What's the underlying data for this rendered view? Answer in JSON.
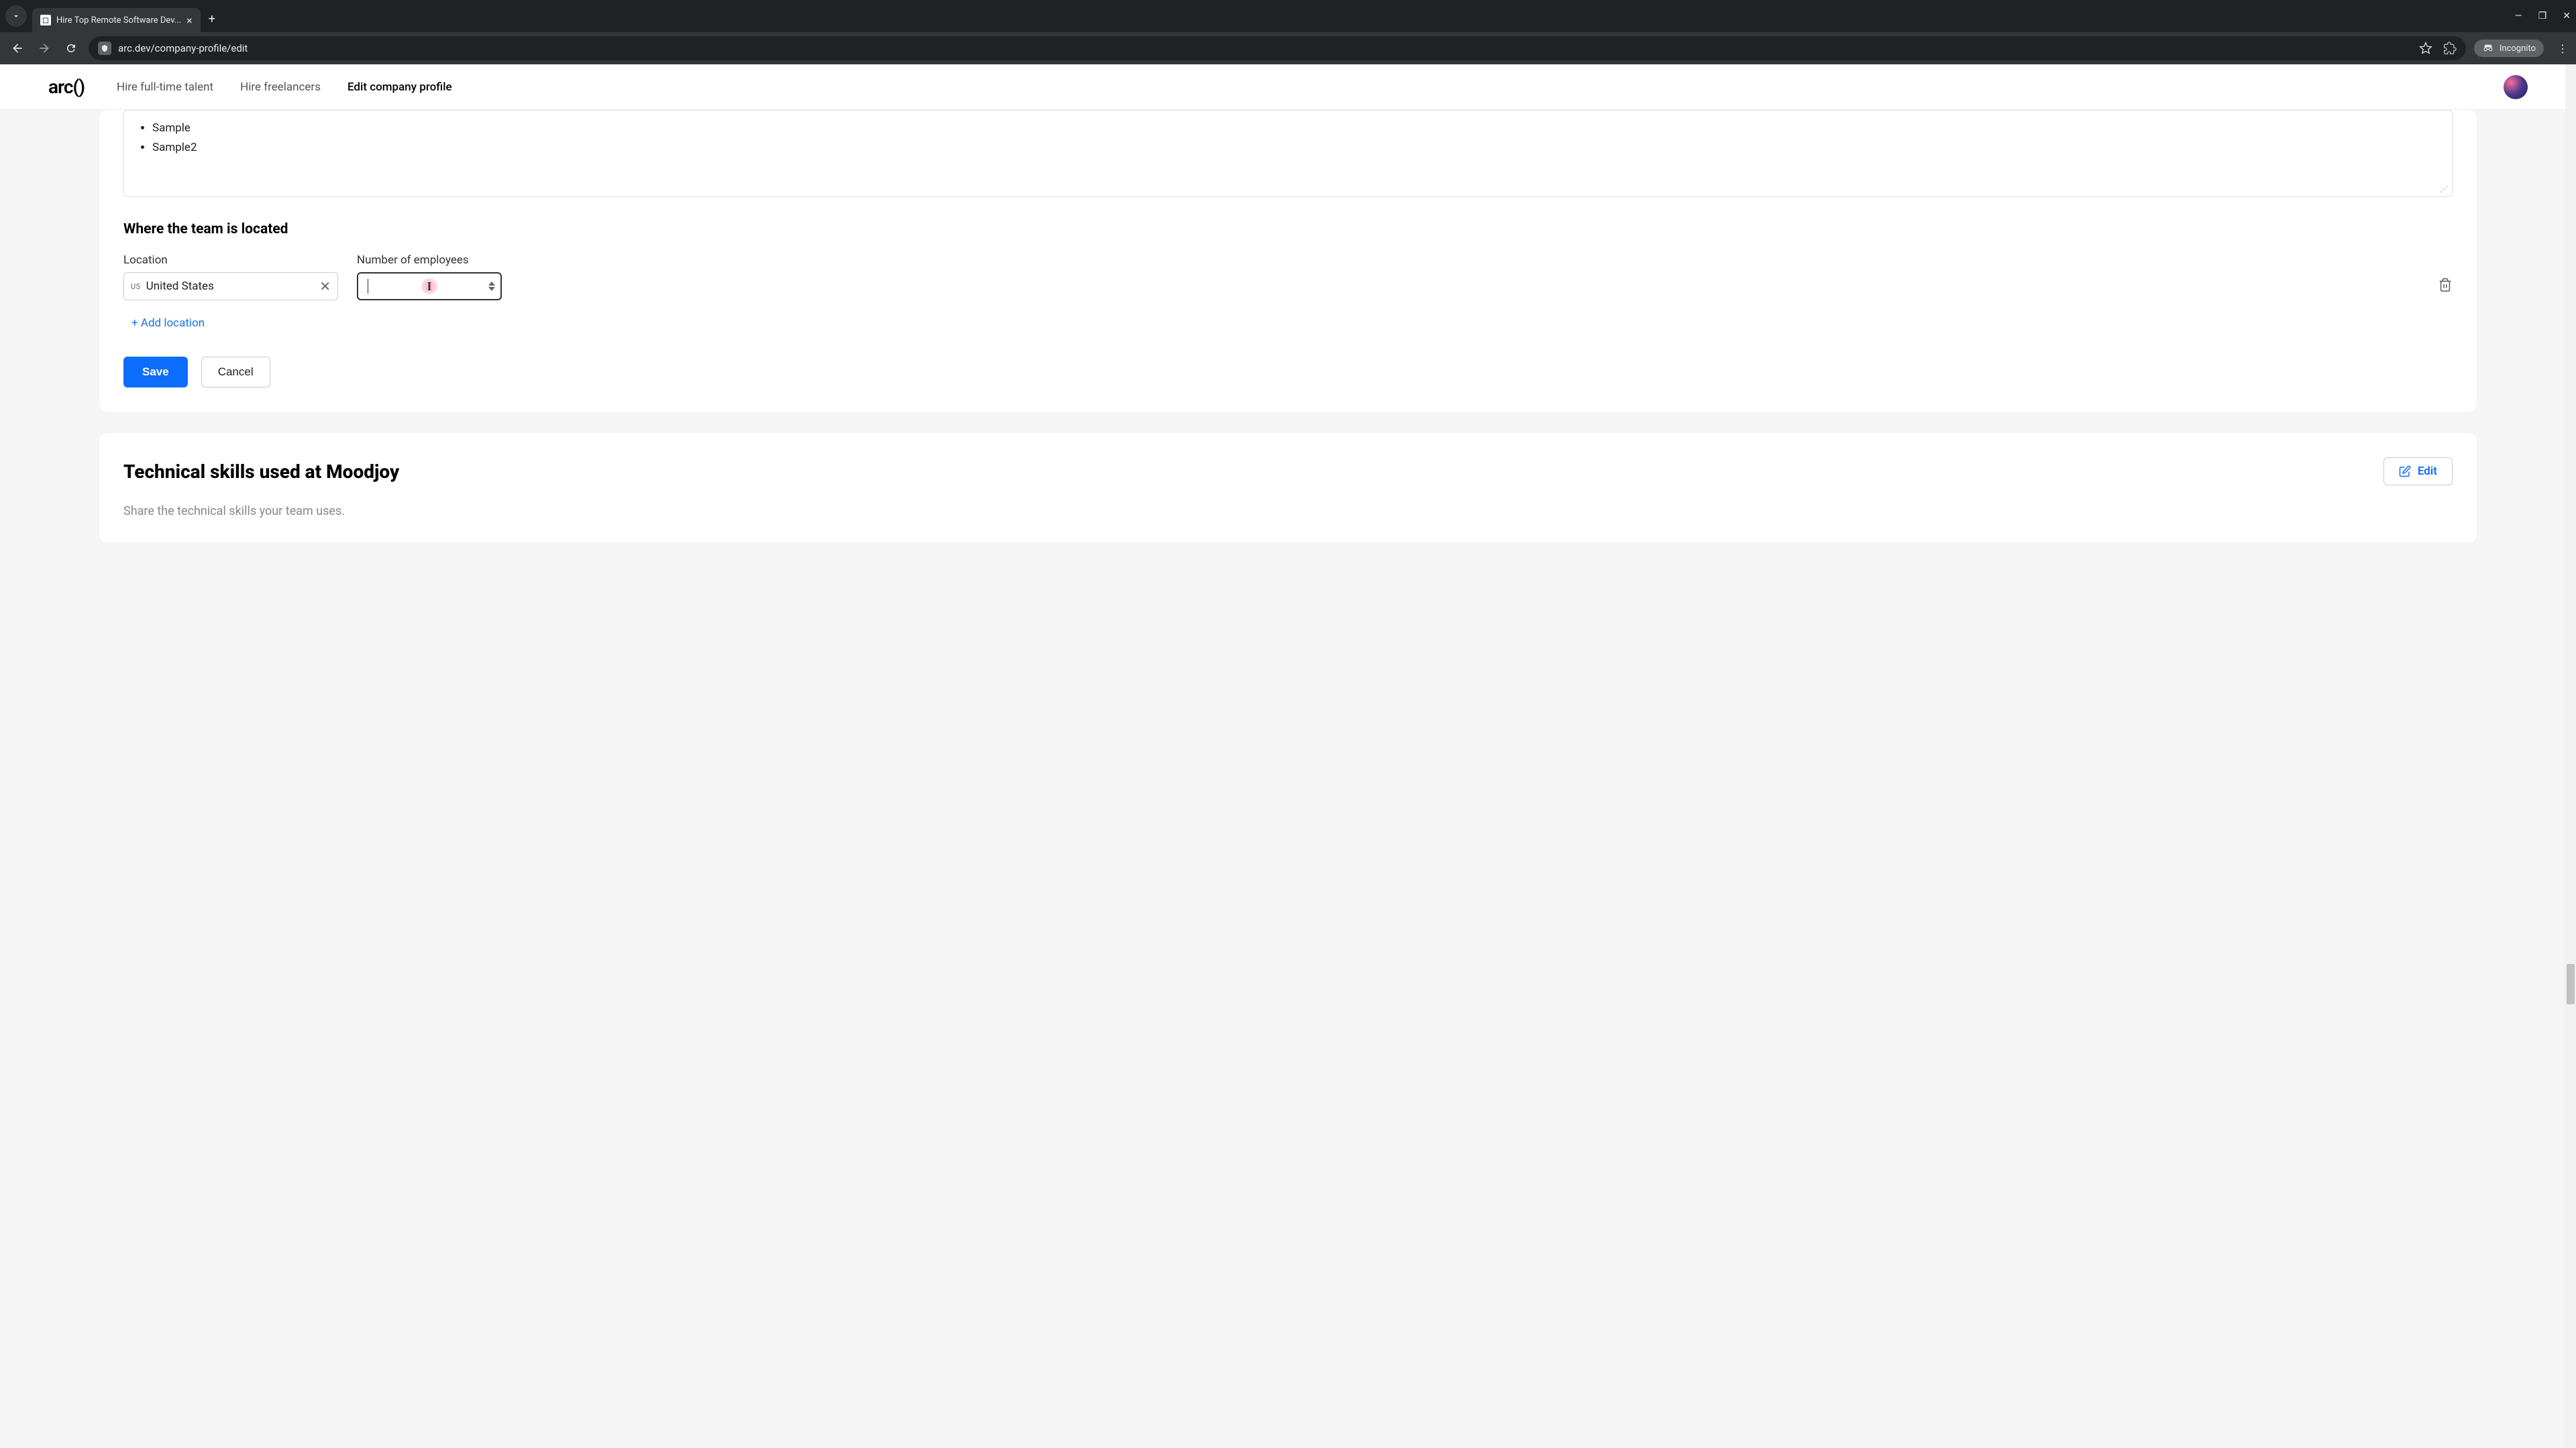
{
  "browser": {
    "tab_title": "Hire Top Remote Software Dev...",
    "url": "arc.dev/company-profile/edit",
    "incognito_label": "Incognito"
  },
  "header": {
    "logo": "arc()",
    "nav": {
      "hire_fulltime": "Hire full-time talent",
      "hire_freelancers": "Hire freelancers",
      "edit_profile": "Edit company profile"
    }
  },
  "textarea": {
    "items": [
      "Sample",
      "Sample2"
    ]
  },
  "location_section": {
    "heading": "Where the team is located",
    "location_label": "Location",
    "employees_label": "Number of employees",
    "location_prefix": "US",
    "location_value": "United States",
    "employees_value": "",
    "add_location": "+ Add location"
  },
  "buttons": {
    "save": "Save",
    "cancel": "Cancel",
    "edit": "Edit"
  },
  "skills_section": {
    "title": "Technical skills used at Moodjoy",
    "subtext": "Share the technical skills your team uses."
  }
}
